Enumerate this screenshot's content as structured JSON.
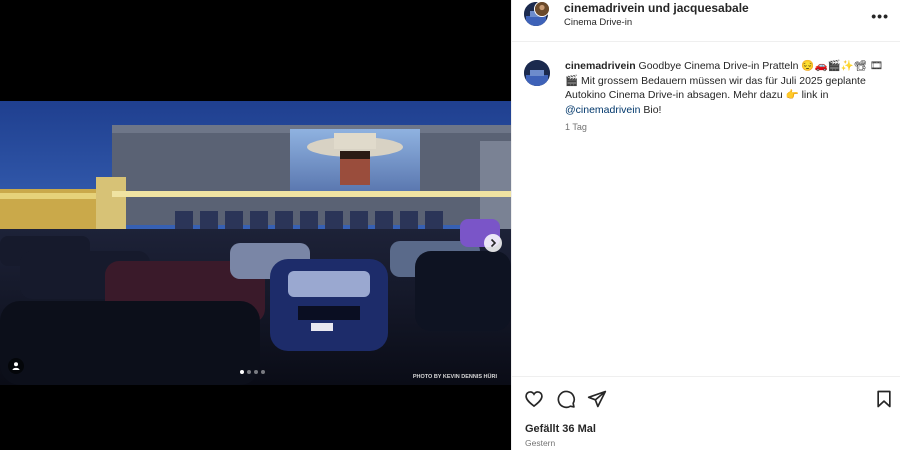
{
  "post": {
    "photo_credit": "PHOTO BY KEVIN DENNIS HÜRI",
    "carousel_dots": 4,
    "carousel_active": 1
  },
  "header": {
    "title": "cinemadrivein und jacquesabale",
    "subtitle": "Cinema Drive-in",
    "more_label": "•••"
  },
  "caption": {
    "username": "cinemadrivein",
    "text_1": " Goodbye Cinema Drive-in Pratteln 😔🚗🎬✨📽 🎞 🎬 Mit grossem Bedauern müssen wir das für Juli 2025 geplante Autokino Cinema Drive-in absagen. Mehr dazu 👉 link in ",
    "mention": "@cinemadrivein",
    "text_2": " Bio!",
    "time": "1 Tag"
  },
  "footer": {
    "likes": "Gefällt 36 Mal",
    "date": "Gestern"
  },
  "icons": {
    "like": "heart-icon",
    "comment": "comment-icon",
    "share": "share-icon",
    "save": "bookmark-icon",
    "next": "chevron-right-icon",
    "tags": "user-tag-icon"
  }
}
